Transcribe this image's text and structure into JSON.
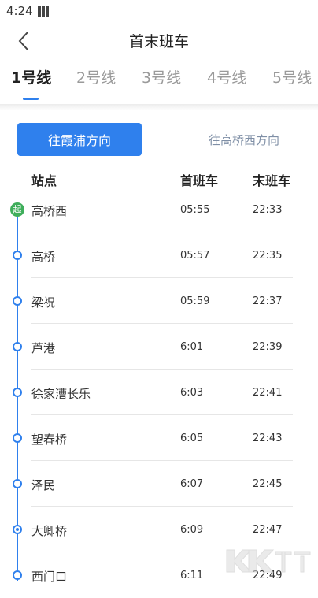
{
  "status_bar": {
    "time": "4:24"
  },
  "nav": {
    "title": "首末班车"
  },
  "line_tabs": [
    {
      "label": "1号线"
    },
    {
      "label": "2号线"
    },
    {
      "label": "3号线"
    },
    {
      "label": "4号线"
    },
    {
      "label": "5号线"
    }
  ],
  "directions": {
    "active": "往霞浦方向",
    "other": "往高桥西方向"
  },
  "table": {
    "headers": {
      "station": "站点",
      "first": "首班车",
      "last": "末班车"
    },
    "start_badge": "起",
    "rows": [
      {
        "station": "高桥西",
        "first": "05:55",
        "last": "22:33"
      },
      {
        "station": "高桥",
        "first": "05:57",
        "last": "22:35"
      },
      {
        "station": "梁祝",
        "first": "05:59",
        "last": "22:37"
      },
      {
        "station": "芦港",
        "first": "6:01",
        "last": "22:39"
      },
      {
        "station": "徐家漕长乐",
        "first": "6:03",
        "last": "22:41"
      },
      {
        "station": "望春桥",
        "first": "6:05",
        "last": "22:43"
      },
      {
        "station": "泽民",
        "first": "6:07",
        "last": "22:45"
      },
      {
        "station": "大卿桥",
        "first": "6:09",
        "last": "22:47"
      },
      {
        "station": "西门口",
        "first": "6:11",
        "last": "22:49"
      }
    ]
  },
  "colors": {
    "accent": "#2f80ed",
    "start_node": "#3fae5b",
    "inactive_text": "#9a9a9a"
  }
}
